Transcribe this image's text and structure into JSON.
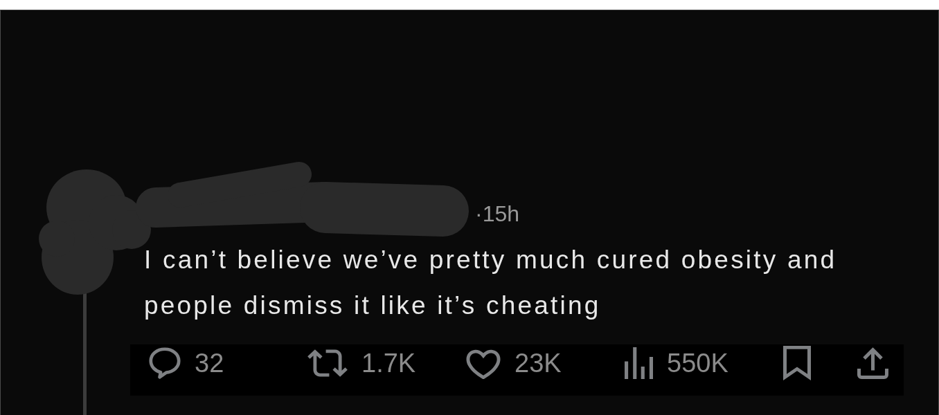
{
  "post": {
    "timestamp": "·15h",
    "text": "I can’t believe we’ve pretty much cured obesity and people dismiss it like it’s cheating"
  },
  "actions": [
    {
      "kind": "reply",
      "count": "32"
    },
    {
      "kind": "repost",
      "count": "1.7K"
    },
    {
      "kind": "like",
      "count": "23K"
    },
    {
      "kind": "views",
      "count": "550K"
    },
    {
      "kind": "bookmark"
    },
    {
      "kind": "share"
    }
  ]
}
